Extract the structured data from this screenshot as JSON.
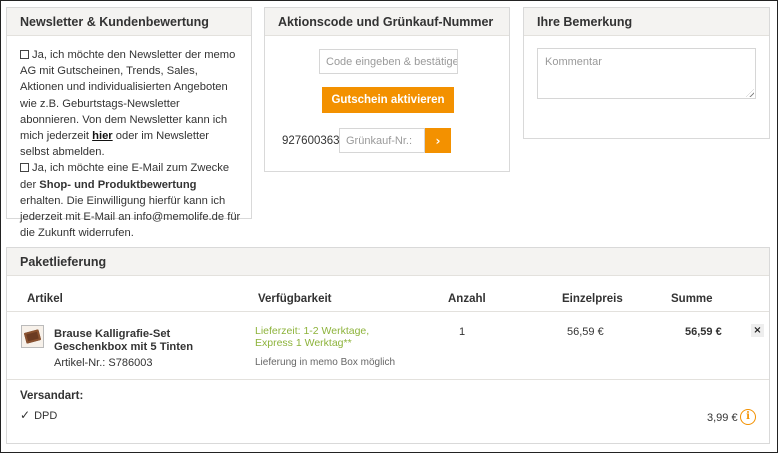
{
  "newsletter": {
    "title": "Newsletter & Kundenbewertung",
    "option1_text_a": "Ja, ich möchte den Newsletter der memo AG mit Gutscheinen, Trends, Sales, Aktionen und individualisierten Angeboten wie z.B. Geburtstags-Newsletter abonnieren. Von dem Newsletter kann ich mich jederzeit ",
    "option1_link": "hier",
    "option1_text_b": " oder im Newsletter selbst abmelden.",
    "option2_text_a": "Ja, ich möchte eine E-Mail zum Zwecke der ",
    "option2_bold": "Shop- und Produktbewertung",
    "option2_text_b": " erhalten. Die Einwilligung hierfür kann ich jederzeit mit E-Mail an info@memolife.de für die Zukunft widerrufen."
  },
  "promo": {
    "title": "Aktionscode und Grünkauf-Nummer",
    "code_placeholder": "Code eingeben & bestätigen",
    "activate_label": "Gutschein aktivieren",
    "gruenkauf_prefix": "927600363",
    "gruenkauf_placeholder": "Grünkauf-Nr.:",
    "submit_glyph": "›"
  },
  "remark": {
    "title": "Ihre Bemerkung",
    "placeholder": "Kommentar"
  },
  "shipping": {
    "title": "Paketlieferung",
    "columns": {
      "article": "Artikel",
      "availability": "Verfügbarkeit",
      "quantity": "Anzahl",
      "unit_price": "Einzelpreis",
      "total": "Summe"
    },
    "item": {
      "name": "Brause Kalligrafie-Set Geschenkbox mit 5 Tinten",
      "article_no": "Artikel-Nr.: S786003",
      "availability": "Lieferzeit: 1-2 Werktage, Express 1 Werktag**",
      "availability_note": "Lieferung in memo Box möglich",
      "quantity": "1",
      "unit_price": "56,59 €",
      "total": "56,59 €",
      "remove_glyph": "×"
    },
    "method_label": "Versandart:",
    "method": "DPD",
    "method_price": "3,99 €",
    "info_glyph": "i"
  },
  "colors": {
    "accent": "#f39100",
    "availability_green": "#8db33b",
    "panel_header": "#f4f3f1"
  }
}
